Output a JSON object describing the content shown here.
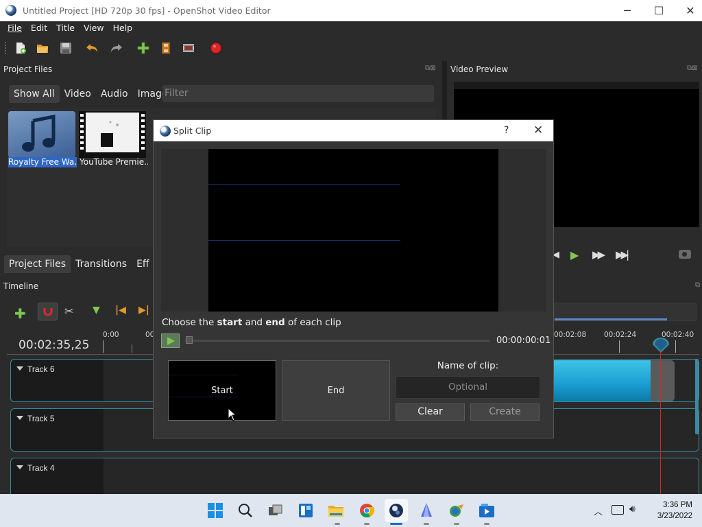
{
  "window": {
    "title": "Untitled Project [HD 720p 30 fps] - OpenShot Video Editor",
    "minimize": "─",
    "maximize": "☐",
    "close": "✕"
  },
  "menu": [
    "File",
    "Edit",
    "Title",
    "View",
    "Help"
  ],
  "toolbar_icons": [
    "new-project-icon",
    "open-project-icon",
    "save-project-icon",
    "undo-icon",
    "redo-icon",
    "import-files-icon",
    "profile-icon",
    "fullscreen-icon",
    "export-icon"
  ],
  "project_files": {
    "title": "Project Files",
    "tabs": [
      "Show All",
      "Video",
      "Audio",
      "Image"
    ],
    "filter_placeholder": "Filter",
    "files": [
      {
        "name": "Royalty Free Wa...",
        "selected": true
      },
      {
        "name": "YouTube Premie...",
        "selected": false
      }
    ]
  },
  "bottom_tabs": [
    "Project Files",
    "Transitions",
    "Eff"
  ],
  "video_preview": {
    "title": "Video Preview"
  },
  "timeline": {
    "title": "Timeline",
    "current_time": "00:02:35,25",
    "ruler_labels": [
      "0:00",
      "00",
      "00:02:08",
      "00:02:24",
      "00:02:40"
    ],
    "tracks": [
      "Track 6",
      "Track 5",
      "Track 4"
    ]
  },
  "dialog": {
    "title": "Split Clip",
    "help": "?",
    "close": "✕",
    "instruction_pre": "Choose the ",
    "instruction_start": "start",
    "instruction_mid": " and ",
    "instruction_end": "end",
    "instruction_post": " of each clip",
    "time": "00:00:00:01",
    "slider_position": 0,
    "start_label": "Start",
    "end_label": "End",
    "name_label": "Name of clip:",
    "name_placeholder": "Optional",
    "clear_label": "Clear",
    "create_label": "Create"
  },
  "taskbar": {
    "time": "3:36 PM",
    "date": "3/23/2022"
  },
  "colors": {
    "accent": "#3a8aa0",
    "play_green": "#7ec84f",
    "playhead_red": "#d9262b",
    "record_red": "#e0242c",
    "selection_blue": "#3067c6"
  }
}
